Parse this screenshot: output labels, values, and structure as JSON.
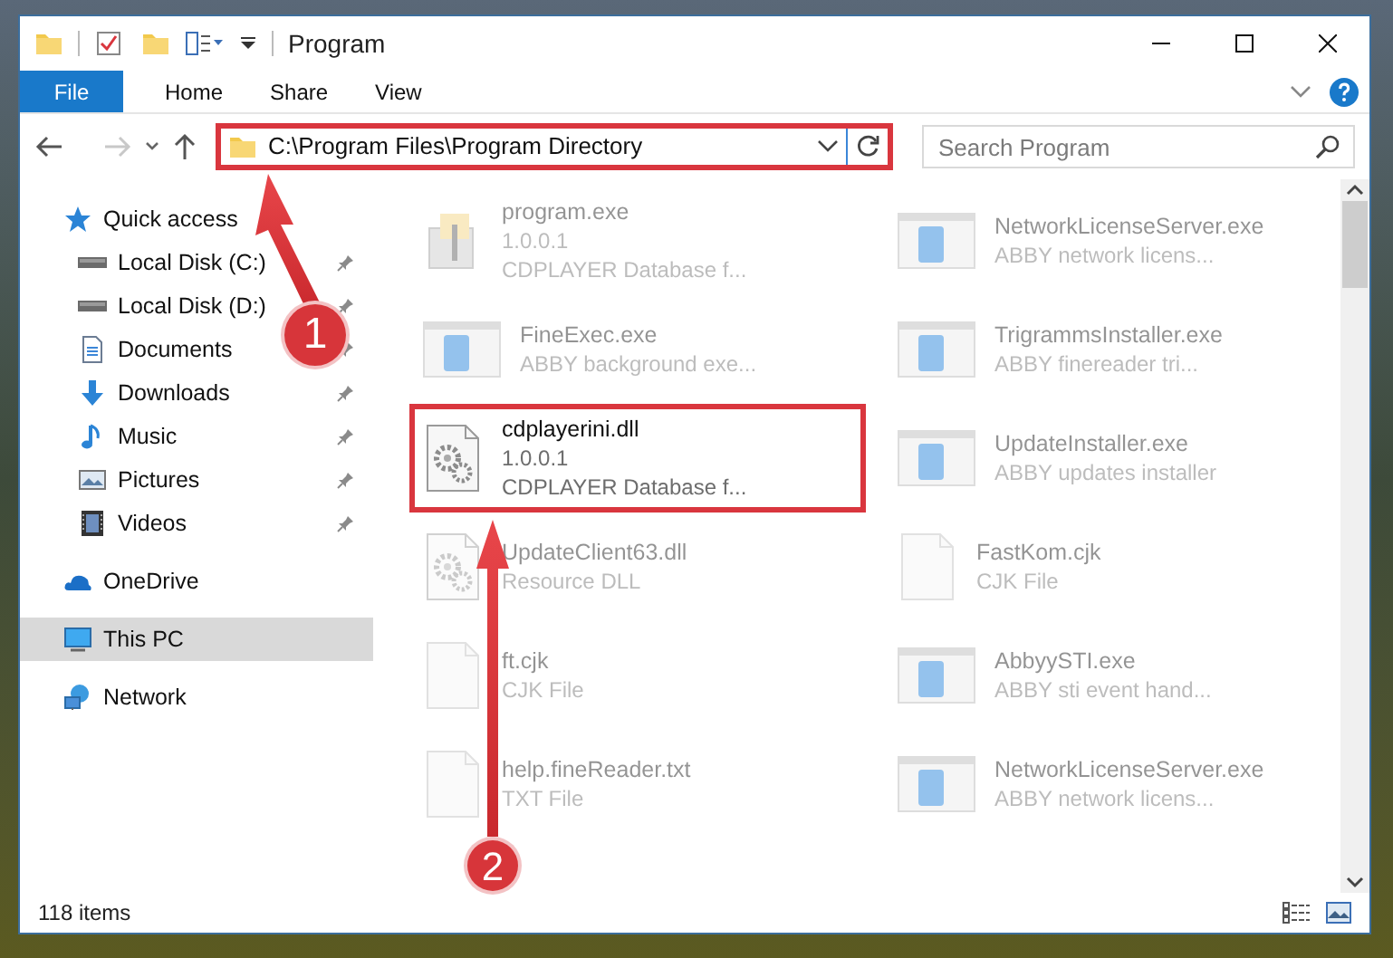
{
  "window": {
    "title": "Program"
  },
  "ribbon_tabs": [
    {
      "label": "File",
      "selected": true
    },
    {
      "label": "Home",
      "selected": false
    },
    {
      "label": "Share",
      "selected": false
    },
    {
      "label": "View",
      "selected": false
    }
  ],
  "address_bar": {
    "path": "C:\\Program Files\\Program Directory",
    "highlighted": true
  },
  "search": {
    "placeholder": "Search Program"
  },
  "nav_pane": [
    {
      "label": "Quick access",
      "kind": "star",
      "selected": false,
      "children": [
        {
          "label": "Local Disk (C:)",
          "kind": "disk",
          "pinned": true,
          "selected": false
        },
        {
          "label": "Local Disk (D:)",
          "kind": "disk",
          "pinned": true,
          "selected": false
        },
        {
          "label": "Documents",
          "kind": "documents",
          "pinned": true,
          "selected": false
        },
        {
          "label": "Downloads",
          "kind": "downloads",
          "pinned": true,
          "selected": false
        },
        {
          "label": "Music",
          "kind": "music",
          "pinned": true,
          "selected": false
        },
        {
          "label": "Pictures",
          "kind": "pictures",
          "pinned": true,
          "selected": false
        },
        {
          "label": "Videos",
          "kind": "videos",
          "pinned": true,
          "selected": false
        }
      ]
    },
    {
      "label": "OneDrive",
      "kind": "cloud",
      "selected": false
    },
    {
      "label": "This PC",
      "kind": "pc",
      "selected": true
    },
    {
      "label": "Network",
      "kind": "network",
      "selected": false
    }
  ],
  "files": [
    {
      "name": "program.exe",
      "lines": [
        "1.0.0.1",
        "CDPLAYER Database f..."
      ],
      "kind": "installer",
      "dimmed": true,
      "highlighted": false
    },
    {
      "name": "NetworkLicenseServer.exe",
      "lines": [
        "ABBY network licens..."
      ],
      "kind": "app",
      "dimmed": true,
      "highlighted": false
    },
    {
      "name": "FineExec.exe",
      "lines": [
        "ABBY background exe..."
      ],
      "kind": "app",
      "dimmed": true,
      "highlighted": false
    },
    {
      "name": "TrigrammsInstaller.exe",
      "lines": [
        "ABBY finereader tri..."
      ],
      "kind": "app",
      "dimmed": true,
      "highlighted": false
    },
    {
      "name": "cdplayerini.dll",
      "lines": [
        "1.0.0.1",
        "CDPLAYER Database f..."
      ],
      "kind": "dll",
      "dimmed": false,
      "highlighted": true
    },
    {
      "name": "UpdateInstaller.exe",
      "lines": [
        "ABBY updates installer"
      ],
      "kind": "app",
      "dimmed": true,
      "highlighted": false
    },
    {
      "name": "UpdateClient63.dll",
      "lines": [
        "Resource DLL"
      ],
      "kind": "dll",
      "dimmed": true,
      "highlighted": false
    },
    {
      "name": "FastKom.cjk",
      "lines": [
        "CJK File"
      ],
      "kind": "blank",
      "dimmed": true,
      "highlighted": false
    },
    {
      "name": "ft.cjk",
      "lines": [
        "CJK File"
      ],
      "kind": "blank",
      "dimmed": true,
      "highlighted": false
    },
    {
      "name": "AbbyySTI.exe",
      "lines": [
        "ABBY sti event hand..."
      ],
      "kind": "app",
      "dimmed": true,
      "highlighted": false
    },
    {
      "name": "help.fineReader.txt",
      "lines": [
        "TXT File"
      ],
      "kind": "blank",
      "dimmed": true,
      "highlighted": false
    },
    {
      "name": "NetworkLicenseServer.exe",
      "lines": [
        "ABBY network licens..."
      ],
      "kind": "app",
      "dimmed": true,
      "highlighted": false
    }
  ],
  "status_bar": {
    "item_count": "118 items"
  },
  "annotations": [
    {
      "number": "1"
    },
    {
      "number": "2"
    }
  ]
}
